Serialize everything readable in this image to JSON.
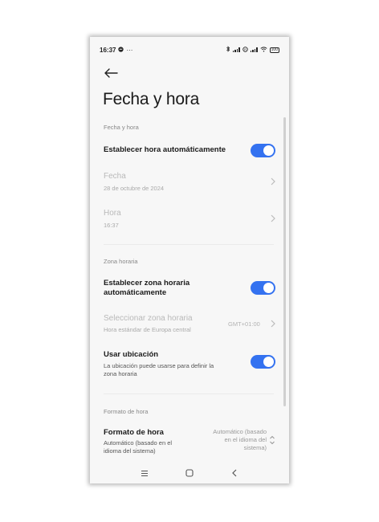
{
  "status_bar": {
    "time": "16:37",
    "battery": "100"
  },
  "header": {
    "title": "Fecha y hora"
  },
  "sections": {
    "date_time": {
      "header": "Fecha y hora",
      "auto_time_label": "Establecer hora automáticamente",
      "auto_time_enabled": true,
      "date_label": "Fecha",
      "date_value": "28 de octubre de 2024",
      "time_label": "Hora",
      "time_value": "16:37"
    },
    "timezone": {
      "header": "Zona horaria",
      "auto_tz_label_line1": "Establecer zona horaria",
      "auto_tz_label_line2": "automáticamente",
      "auto_tz_enabled": true,
      "select_tz_label": "Seleccionar zona horaria",
      "select_tz_value": "Hora estándar de Europa central",
      "select_tz_offset": "GMT+01:00",
      "use_location_label": "Usar ubicación",
      "use_location_desc_line1": "La ubicación puede usarse para definir la",
      "use_location_desc_line2": "zona horaria",
      "use_location_enabled": true
    },
    "time_format": {
      "header": "Formato de hora",
      "format_label": "Formato de hora",
      "format_desc_line1": "Automático (basado en el",
      "format_desc_line2": "idioma del sistema)",
      "format_value_line1": "Automático (basado",
      "format_value_line2": "en el idioma del",
      "format_value_line3": "sistema)"
    }
  },
  "colors": {
    "accent": "#3472f0",
    "disabled_text": "#b9b9b9",
    "section_header": "#888888",
    "background": "#f7f7f7"
  }
}
